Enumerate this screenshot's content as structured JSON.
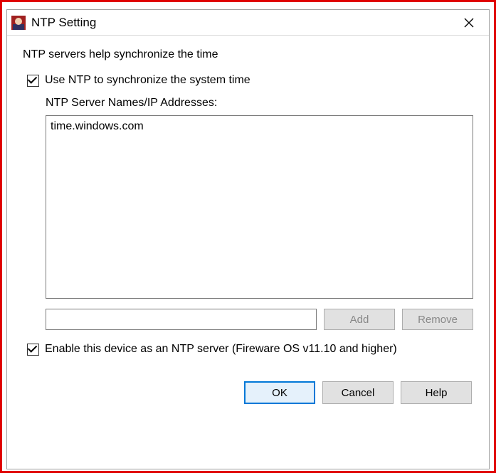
{
  "window": {
    "title": "NTP Setting"
  },
  "intro_text": "NTP servers help synchronize the time",
  "use_ntp": {
    "label": "Use NTP to synchronize the system time",
    "checked": true
  },
  "server_list": {
    "label": "NTP Server Names/IP Addresses:",
    "items": [
      "time.windows.com"
    ]
  },
  "new_server_input": "",
  "buttons": {
    "add": "Add",
    "remove": "Remove",
    "ok": "OK",
    "cancel": "Cancel",
    "help": "Help"
  },
  "enable_server": {
    "label": "Enable this device as an NTP server (Fireware OS v11.10 and higher)",
    "checked": true
  }
}
